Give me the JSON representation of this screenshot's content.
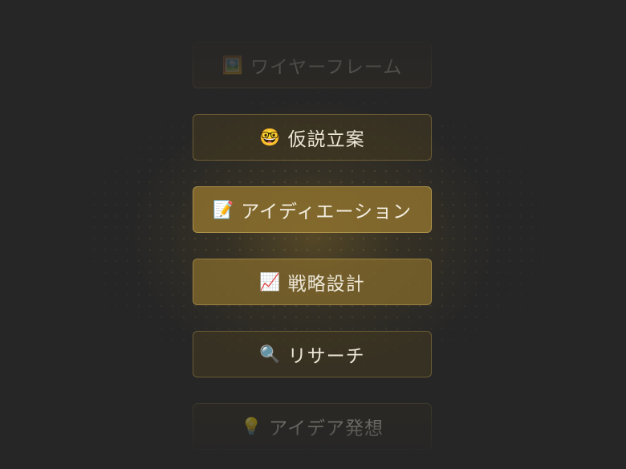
{
  "menu": {
    "items": [
      {
        "label": "ワイヤーフレーム",
        "icon": "🖼️",
        "icon_name": "picture-icon"
      },
      {
        "label": "仮説立案",
        "icon": "🤓",
        "icon_name": "nerd-face-icon"
      },
      {
        "label": "アイディエーション",
        "icon": "📝",
        "icon_name": "memo-icon"
      },
      {
        "label": "戦略設計",
        "icon": "📈",
        "icon_name": "chart-increasing-icon"
      },
      {
        "label": "リサーチ",
        "icon": "🔍",
        "icon_name": "magnifying-glass-icon"
      },
      {
        "label": "アイデア発想",
        "icon": "💡",
        "icon_name": "light-bulb-icon"
      }
    ]
  },
  "colors": {
    "background": "#262626",
    "accent": "#8c702e",
    "text": "#ece6d6"
  }
}
